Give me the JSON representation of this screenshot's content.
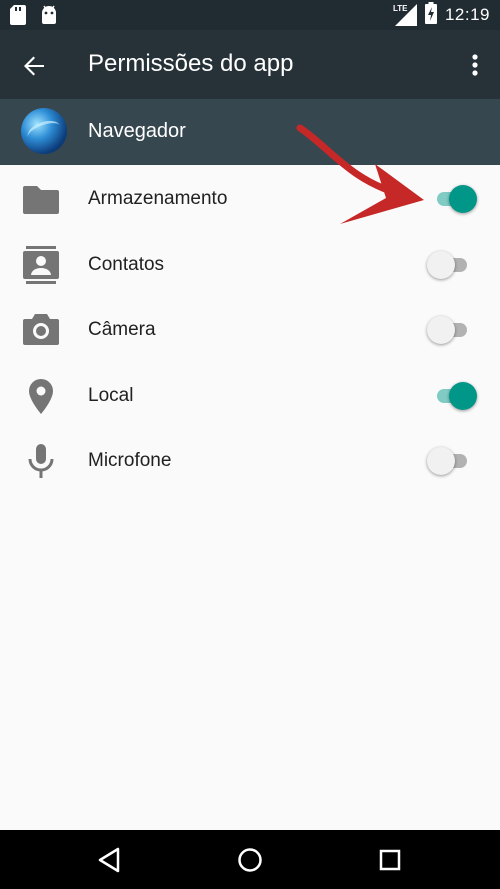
{
  "status_bar": {
    "time": "12:19",
    "network": "LTE",
    "icons": [
      "sd-card-icon",
      "android-icon",
      "signal-icon",
      "battery-charging-icon"
    ]
  },
  "toolbar": {
    "title": "Permissões do app",
    "back_icon": "arrow-back-icon",
    "menu_icon": "more-vert-icon"
  },
  "app": {
    "name": "Navegador",
    "icon": "globe-app-icon"
  },
  "permissions": [
    {
      "label": "Armazenamento",
      "icon": "folder-icon",
      "enabled": true
    },
    {
      "label": "Contatos",
      "icon": "contacts-icon",
      "enabled": false
    },
    {
      "label": "Câmera",
      "icon": "camera-icon",
      "enabled": false
    },
    {
      "label": "Local",
      "icon": "location-icon",
      "enabled": true
    },
    {
      "label": "Microfone",
      "icon": "microphone-icon",
      "enabled": false
    }
  ],
  "colors": {
    "toolbar": "#263238",
    "status_bar": "#202b32",
    "app_header": "#37474f",
    "accent": "#009688",
    "icon_gray": "#757575",
    "annotation_red": "#c62828"
  },
  "nav_bar": {
    "buttons": [
      "back-triangle-icon",
      "home-circle-icon",
      "recents-square-icon"
    ]
  }
}
